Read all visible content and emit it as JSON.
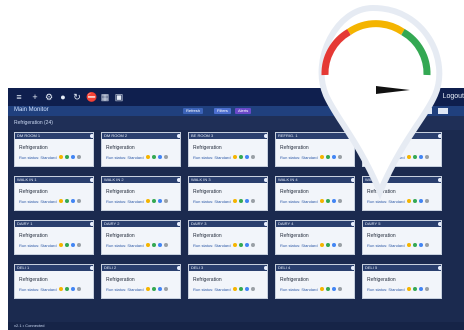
{
  "app": {
    "menu_title": "Main Monitor",
    "logout_label": "Logout",
    "nav_pills": [
      "Refresh",
      "Filters",
      "Alerts"
    ],
    "group_label": "Refrigeration (24)"
  },
  "cards": [
    {
      "header": "DM ROOM 1",
      "name": "Refrigeration",
      "status": "Run status: Standard"
    },
    {
      "header": "DM ROOM 2",
      "name": "Refrigeration",
      "status": "Run status: Standard"
    },
    {
      "header": "BE ROOM 3",
      "name": "Refrigeration",
      "status": "Run status: Standard"
    },
    {
      "header": "REFRIG. 1",
      "name": "Refrigeration",
      "status": "Run status: Standard"
    },
    {
      "header": "FREEZER 1",
      "name": "Refrigeration",
      "status": "Run status: Standard"
    },
    {
      "header": "WALK IN 1",
      "name": "Refrigeration",
      "status": "Run status: Standard"
    },
    {
      "header": "WALK IN 2",
      "name": "Refrigeration",
      "status": "Run status: Standard"
    },
    {
      "header": "WALK IN 3",
      "name": "Refrigeration",
      "status": "Run status: Standard"
    },
    {
      "header": "WALK IN 4",
      "name": "Refrigeration",
      "status": "Run status: Standard"
    },
    {
      "header": "WALK IN 5",
      "name": "Refrigeration",
      "status": "Run status: Standard"
    },
    {
      "header": "DAIRY 1",
      "name": "Refrigeration",
      "status": "Run status: Standard"
    },
    {
      "header": "DAIRY 2",
      "name": "Refrigeration",
      "status": "Run status: Standard"
    },
    {
      "header": "DAIRY 3",
      "name": "Refrigeration",
      "status": "Run status: Standard"
    },
    {
      "header": "DAIRY 4",
      "name": "Refrigeration",
      "status": "Run status: Standard"
    },
    {
      "header": "DAIRY 5",
      "name": "Refrigeration",
      "status": "Run status: Standard"
    },
    {
      "header": "DELI 1",
      "name": "Refrigeration",
      "status": "Run status: Standard"
    },
    {
      "header": "DELI 2",
      "name": "Refrigeration",
      "status": "Run status: Standard"
    },
    {
      "header": "DELI 3",
      "name": "Refrigeration",
      "status": "Run status: Standard"
    },
    {
      "header": "DELI 4",
      "name": "Refrigeration",
      "status": "Run status: Standard"
    },
    {
      "header": "DELI 5",
      "name": "Refrigeration",
      "status": "Run status: Standard"
    }
  ],
  "footer": {
    "left_text": "v2.1 • Connected"
  },
  "gauge": {
    "colors": [
      "#e53935",
      "#f4b400",
      "#34a853"
    ],
    "needle_color": "#111111"
  }
}
